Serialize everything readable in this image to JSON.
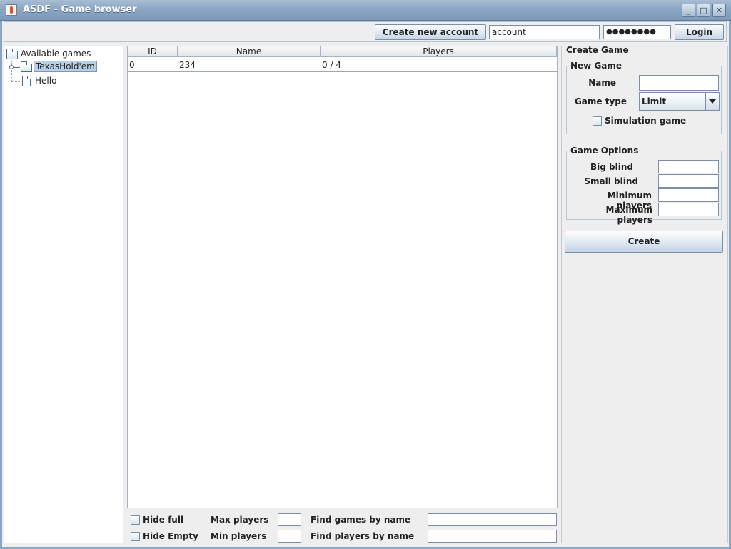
{
  "window": {
    "title": "ASDF - Game browser",
    "min": "_",
    "max": "□",
    "close": "✕"
  },
  "toolbar": {
    "create_account_label": "Create new account",
    "account_value": "account",
    "password_value": "●●●●●●●●",
    "login_label": "Login"
  },
  "tree": {
    "root_label": "Available games",
    "items": [
      {
        "label": "TexasHold'em",
        "selected": true
      },
      {
        "label": "Hello",
        "selected": false
      }
    ]
  },
  "table": {
    "columns": [
      "ID",
      "Name",
      "Players"
    ],
    "rows": [
      {
        "id": "0",
        "name": "234",
        "players": "0 / 4"
      }
    ]
  },
  "filters": {
    "hide_full": "Hide full",
    "hide_empty": "Hide Empty",
    "max_players": "Max players",
    "min_players": "Min players",
    "find_games": "Find games by name",
    "find_players": "Find players by name"
  },
  "create_game": {
    "title": "Create Game",
    "new_game_legend": "New Game",
    "name_label": "Name",
    "game_type_label": "Game type",
    "game_type_value": "Limit",
    "simulation_label": "Simulation game",
    "options_legend": "Game Options",
    "big_blind_label": "Big blind",
    "small_blind_label": "Small blind",
    "min_players_label": "Minimum players",
    "max_players_label": "Maximum players",
    "create_label": "Create"
  }
}
